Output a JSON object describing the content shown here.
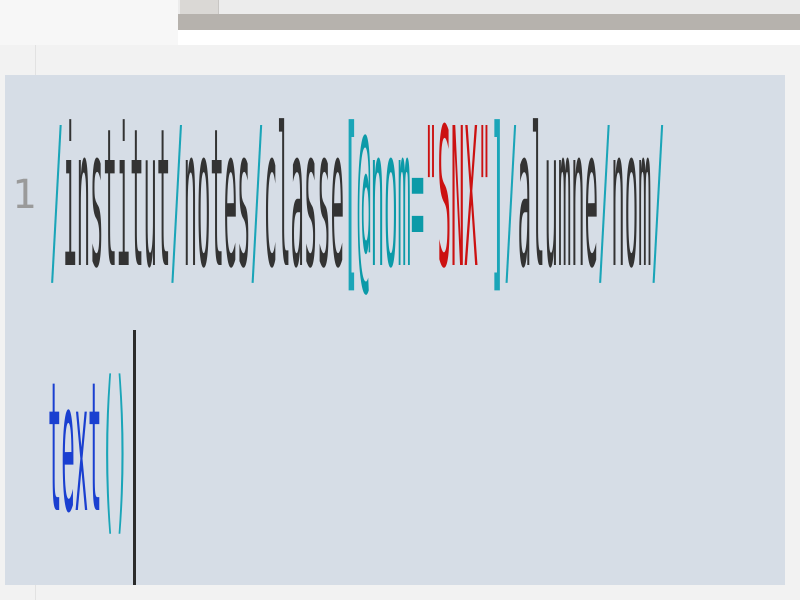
{
  "editor": {
    "line_number": "1",
    "line1": {
      "s1": "/",
      "p1": "institut",
      "s2": "/",
      "p2": "notes",
      "s3": "/",
      "p3": "classe",
      "b_open": "[",
      "attr": "@nom",
      "eq": "=",
      "string": "\"SNX\"",
      "b_close": "]",
      "s4": "/",
      "p4": "alumne",
      "s5": "/",
      "p5": "nom",
      "s6": "/"
    },
    "line2": {
      "func": "text",
      "parens": "()"
    }
  }
}
